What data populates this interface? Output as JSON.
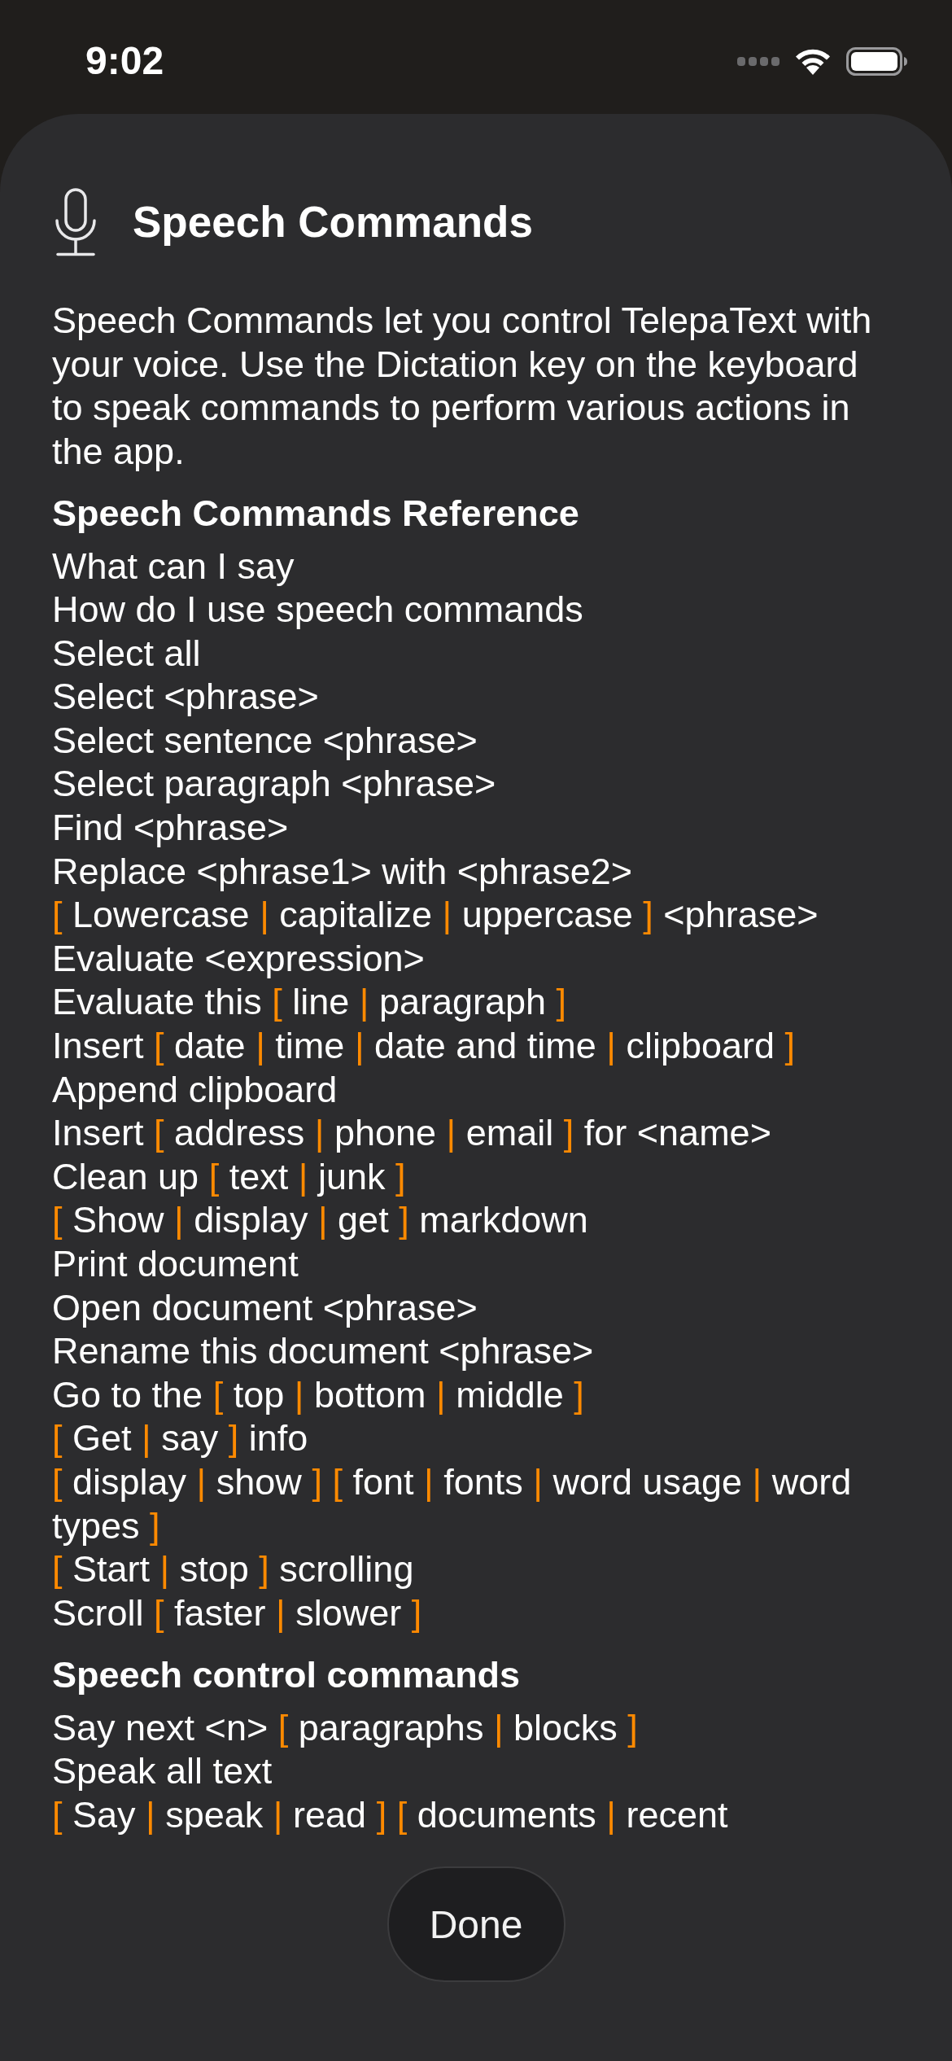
{
  "status_bar": {
    "time": "9:02"
  },
  "sheet": {
    "title": "Speech Commands",
    "intro": "Speech Commands let you control TelepaText with your voice. Use the Dictation key on the keyboard to speak commands to perform various actions in the app.",
    "sections": [
      {
        "heading": "Speech Commands Reference",
        "commands": [
          {
            "segments": [
              {
                "kind": "text",
                "text": "What can I say"
              }
            ]
          },
          {
            "segments": [
              {
                "kind": "text",
                "text": "How do I use speech commands"
              }
            ]
          },
          {
            "segments": [
              {
                "kind": "text",
                "text": "Select all"
              }
            ]
          },
          {
            "segments": [
              {
                "kind": "text",
                "text": "Select <phrase>"
              }
            ]
          },
          {
            "segments": [
              {
                "kind": "text",
                "text": "Select sentence <phrase>"
              }
            ]
          },
          {
            "segments": [
              {
                "kind": "text",
                "text": "Select paragraph <phrase>"
              }
            ]
          },
          {
            "segments": [
              {
                "kind": "text",
                "text": "Find <phrase>"
              }
            ]
          },
          {
            "segments": [
              {
                "kind": "text",
                "text": "Replace <phrase1> with <phrase2>"
              }
            ]
          },
          {
            "segments": [
              {
                "kind": "operator",
                "text": "["
              },
              {
                "kind": "text",
                "text": " Lowercase "
              },
              {
                "kind": "operator",
                "text": "|"
              },
              {
                "kind": "text",
                "text": " capitalize "
              },
              {
                "kind": "operator",
                "text": "|"
              },
              {
                "kind": "text",
                "text": " uppercase "
              },
              {
                "kind": "operator",
                "text": "]"
              },
              {
                "kind": "text",
                "text": " <phrase>"
              }
            ]
          },
          {
            "segments": [
              {
                "kind": "text",
                "text": "Evaluate <expression>"
              }
            ]
          },
          {
            "segments": [
              {
                "kind": "text",
                "text": "Evaluate this "
              },
              {
                "kind": "operator",
                "text": "["
              },
              {
                "kind": "text",
                "text": " line "
              },
              {
                "kind": "operator",
                "text": "|"
              },
              {
                "kind": "text",
                "text": " paragraph "
              },
              {
                "kind": "operator",
                "text": "]"
              }
            ]
          },
          {
            "segments": [
              {
                "kind": "text",
                "text": "Insert "
              },
              {
                "kind": "operator",
                "text": "["
              },
              {
                "kind": "text",
                "text": " date "
              },
              {
                "kind": "operator",
                "text": "|"
              },
              {
                "kind": "text",
                "text": " time "
              },
              {
                "kind": "operator",
                "text": "|"
              },
              {
                "kind": "text",
                "text": " date and time "
              },
              {
                "kind": "operator",
                "text": "|"
              },
              {
                "kind": "text",
                "text": " clipboard "
              },
              {
                "kind": "operator",
                "text": "]"
              }
            ]
          },
          {
            "segments": [
              {
                "kind": "text",
                "text": "Append clipboard"
              }
            ]
          },
          {
            "segments": [
              {
                "kind": "text",
                "text": "Insert "
              },
              {
                "kind": "operator",
                "text": "["
              },
              {
                "kind": "text",
                "text": " address "
              },
              {
                "kind": "operator",
                "text": "|"
              },
              {
                "kind": "text",
                "text": " phone "
              },
              {
                "kind": "operator",
                "text": "|"
              },
              {
                "kind": "text",
                "text": " email "
              },
              {
                "kind": "operator",
                "text": "]"
              },
              {
                "kind": "text",
                "text": " for <name>"
              }
            ]
          },
          {
            "segments": [
              {
                "kind": "text",
                "text": "Clean up "
              },
              {
                "kind": "operator",
                "text": "["
              },
              {
                "kind": "text",
                "text": " text "
              },
              {
                "kind": "operator",
                "text": "|"
              },
              {
                "kind": "text",
                "text": " junk "
              },
              {
                "kind": "operator",
                "text": "]"
              }
            ]
          },
          {
            "segments": [
              {
                "kind": "operator",
                "text": "["
              },
              {
                "kind": "text",
                "text": " Show "
              },
              {
                "kind": "operator",
                "text": "|"
              },
              {
                "kind": "text",
                "text": " display "
              },
              {
                "kind": "operator",
                "text": "|"
              },
              {
                "kind": "text",
                "text": " get "
              },
              {
                "kind": "operator",
                "text": "]"
              },
              {
                "kind": "text",
                "text": " markdown"
              }
            ]
          },
          {
            "segments": [
              {
                "kind": "text",
                "text": "Print document"
              }
            ]
          },
          {
            "segments": [
              {
                "kind": "text",
                "text": "Open document <phrase>"
              }
            ]
          },
          {
            "segments": [
              {
                "kind": "text",
                "text": "Rename this document <phrase>"
              }
            ]
          },
          {
            "segments": [
              {
                "kind": "text",
                "text": "Go to the "
              },
              {
                "kind": "operator",
                "text": "["
              },
              {
                "kind": "text",
                "text": " top "
              },
              {
                "kind": "operator",
                "text": "|"
              },
              {
                "kind": "text",
                "text": " bottom "
              },
              {
                "kind": "operator",
                "text": "|"
              },
              {
                "kind": "text",
                "text": " middle "
              },
              {
                "kind": "operator",
                "text": "]"
              }
            ]
          },
          {
            "segments": [
              {
                "kind": "operator",
                "text": "["
              },
              {
                "kind": "text",
                "text": " Get "
              },
              {
                "kind": "operator",
                "text": "|"
              },
              {
                "kind": "text",
                "text": " say "
              },
              {
                "kind": "operator",
                "text": "]"
              },
              {
                "kind": "text",
                "text": " info"
              }
            ]
          },
          {
            "segments": [
              {
                "kind": "operator",
                "text": "["
              },
              {
                "kind": "text",
                "text": " display "
              },
              {
                "kind": "operator",
                "text": "|"
              },
              {
                "kind": "text",
                "text": " show "
              },
              {
                "kind": "operator",
                "text": "] ["
              },
              {
                "kind": "text",
                "text": " font "
              },
              {
                "kind": "operator",
                "text": "|"
              },
              {
                "kind": "text",
                "text": " fonts "
              },
              {
                "kind": "operator",
                "text": "|"
              },
              {
                "kind": "text",
                "text": " word usage "
              },
              {
                "kind": "operator",
                "text": "|"
              },
              {
                "kind": "text",
                "text": " word types "
              },
              {
                "kind": "operator",
                "text": "]"
              }
            ]
          },
          {
            "segments": [
              {
                "kind": "operator",
                "text": "["
              },
              {
                "kind": "text",
                "text": " Start "
              },
              {
                "kind": "operator",
                "text": "|"
              },
              {
                "kind": "text",
                "text": " stop "
              },
              {
                "kind": "operator",
                "text": "]"
              },
              {
                "kind": "text",
                "text": " scrolling"
              }
            ]
          },
          {
            "segments": [
              {
                "kind": "text",
                "text": "Scroll "
              },
              {
                "kind": "operator",
                "text": "["
              },
              {
                "kind": "text",
                "text": " faster "
              },
              {
                "kind": "operator",
                "text": "|"
              },
              {
                "kind": "text",
                "text": " slower "
              },
              {
                "kind": "operator",
                "text": "]"
              }
            ]
          }
        ]
      },
      {
        "heading": "Speech control commands",
        "commands": [
          {
            "segments": [
              {
                "kind": "text",
                "text": "Say next <n> "
              },
              {
                "kind": "operator",
                "text": "["
              },
              {
                "kind": "text",
                "text": " paragraphs "
              },
              {
                "kind": "operator",
                "text": "|"
              },
              {
                "kind": "text",
                "text": " blocks "
              },
              {
                "kind": "operator",
                "text": "]"
              }
            ]
          },
          {
            "segments": [
              {
                "kind": "text",
                "text": "Speak all text"
              }
            ]
          },
          {
            "segments": [
              {
                "kind": "operator",
                "text": "["
              },
              {
                "kind": "text",
                "text": " Say "
              },
              {
                "kind": "operator",
                "text": "|"
              },
              {
                "kind": "text",
                "text": " speak "
              },
              {
                "kind": "operator",
                "text": "|"
              },
              {
                "kind": "text",
                "text": " read "
              },
              {
                "kind": "operator",
                "text": "] ["
              },
              {
                "kind": "text",
                "text": " documents "
              },
              {
                "kind": "operator",
                "text": "|"
              },
              {
                "kind": "text",
                "text": " recent"
              }
            ]
          }
        ]
      }
    ]
  },
  "done_button": {
    "label": "Done"
  }
}
